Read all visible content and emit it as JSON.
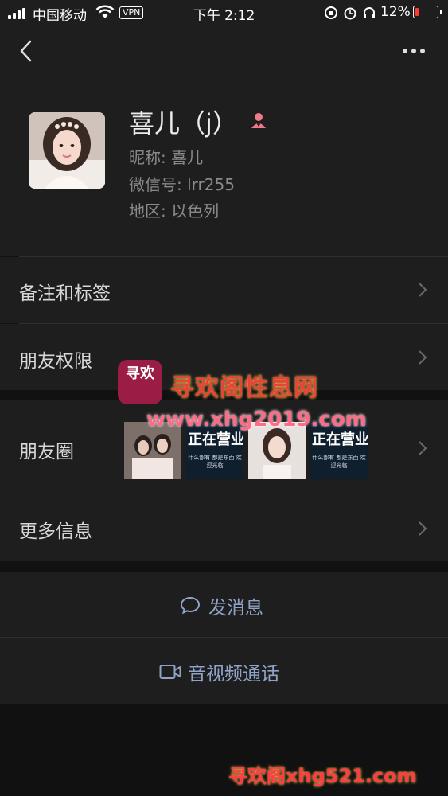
{
  "status_bar": {
    "carrier": "中国移动",
    "vpn": "VPN",
    "time": "下午 2:12",
    "battery": "12%",
    "battery_level": 0.12
  },
  "profile": {
    "display_name": "喜儿（j）",
    "nickname_label": "昵称:",
    "nickname": "喜儿",
    "wechat_id_label": "微信号:",
    "wechat_id": "lrr255",
    "region_label": "地区:",
    "region": "以色列"
  },
  "menu": {
    "remarks_tags": "备注和标签",
    "friend_permissions": "朋友权限",
    "moments": "朋友圈",
    "more_info": "更多信息"
  },
  "moments_thumbs": [
    {
      "text": ""
    },
    {
      "text": "正在营业",
      "sub": "什么都有 都是东西 欢迎光临"
    },
    {
      "text": ""
    },
    {
      "text": "正在营业",
      "sub": "什么都有 都是东西 欢迎光临"
    }
  ],
  "actions": {
    "send_message": "发消息",
    "video_call": "音视频通话"
  },
  "watermark": {
    "title": "寻欢阁性息网",
    "url": "www.xhg2019.com",
    "bottom": "寻欢阁xhg521.com",
    "logo_text": "寻欢"
  },
  "colors": {
    "background": "#111111",
    "panel": "#1e1e1e",
    "link": "#8fa3c7",
    "female_icon": "#f07a8a"
  }
}
